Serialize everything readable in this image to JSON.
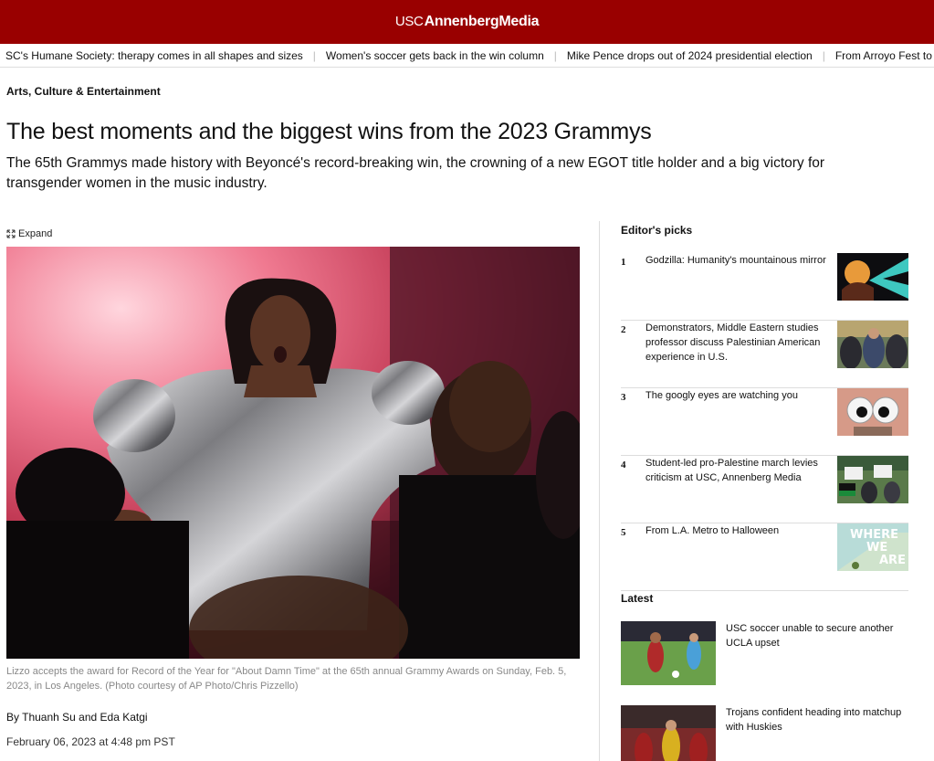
{
  "header": {
    "logo_prefix": "USC",
    "logo_brand": "AnnenbergMedia"
  },
  "ticker": {
    "items": [
      "SC's Humane Society: therapy comes in all shapes and sizes",
      "Women's soccer gets back in the win column",
      "Mike Pence drops out of 2024 presidential election",
      "From Arroyo Fest to Do"
    ]
  },
  "article": {
    "section": "Arts, Culture & Entertainment",
    "headline": "The best moments and the biggest wins from the 2023 Grammys",
    "dek": "The 65th Grammys made history with Beyoncé's record-breaking win, the crowning of a new EGOT title holder and a big victory for transgender women in the music industry.",
    "expand_label": "Expand",
    "caption": "Lizzo accepts the award for Record of the Year for \"About Damn Time\" at the 65th annual Grammy Awards on Sunday, Feb. 5, 2023, in Los Angeles. (Photo courtesy of AP Photo/Chris Pizzello)",
    "byline": "By Thuanh Su and Eda Katgi",
    "date": "February 06, 2023 at 4:48 pm PST"
  },
  "editors_picks": {
    "title": "Editor's picks",
    "items": [
      {
        "num": "1",
        "title": "Godzilla: Humanity's mountainous mirror"
      },
      {
        "num": "2",
        "title": "Demonstrators, Middle Eastern studies professor discuss Palestinian American experience in U.S."
      },
      {
        "num": "3",
        "title": "The googly eyes are watching you"
      },
      {
        "num": "4",
        "title": "Student-led pro-Palestine march levies criticism at USC, Annenberg Media"
      },
      {
        "num": "5",
        "title": "From L.A. Metro to Halloween",
        "thumb_text_1": "WHERE",
        "thumb_text_2": "WE",
        "thumb_text_3": "ARE"
      }
    ]
  },
  "latest": {
    "title": "Latest",
    "items": [
      {
        "title": "USC soccer unable to secure another UCLA upset"
      },
      {
        "title": "Trojans confident heading into matchup with Huskies"
      }
    ]
  },
  "colors": {
    "brand": "#990000"
  }
}
